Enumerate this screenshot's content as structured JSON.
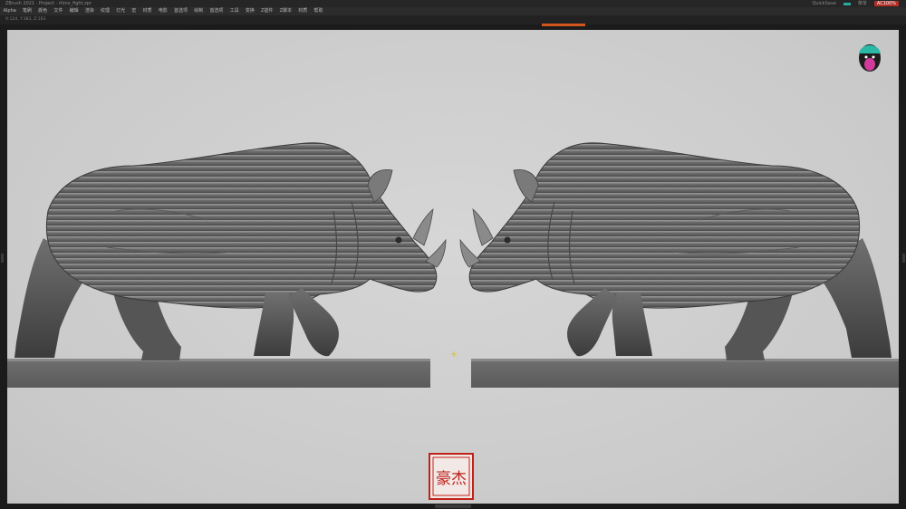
{
  "window": {
    "title": "ZBrush 2021  ·  Project  ·  rhino_fight.zpr",
    "right_items": [
      "QuickSave",
      "菜单"
    ],
    "chip_label": "AC100%"
  },
  "menu": {
    "items": [
      "Alpha",
      "笔刷",
      "颜色",
      "文件",
      "编辑",
      "渲染",
      "纹理",
      "灯光",
      "宏",
      "材质",
      "电影",
      "首选项",
      "绘制",
      "首选项",
      "工具",
      "变换",
      "Z插件",
      "Z脚本",
      "材质",
      "帮助"
    ]
  },
  "status": {
    "text": "X:124, Y:383, Z:163"
  },
  "viewport": {
    "background": "#cdcdcd",
    "seal_text": "豪杰",
    "head_icon": "gizmo-head-icon"
  }
}
